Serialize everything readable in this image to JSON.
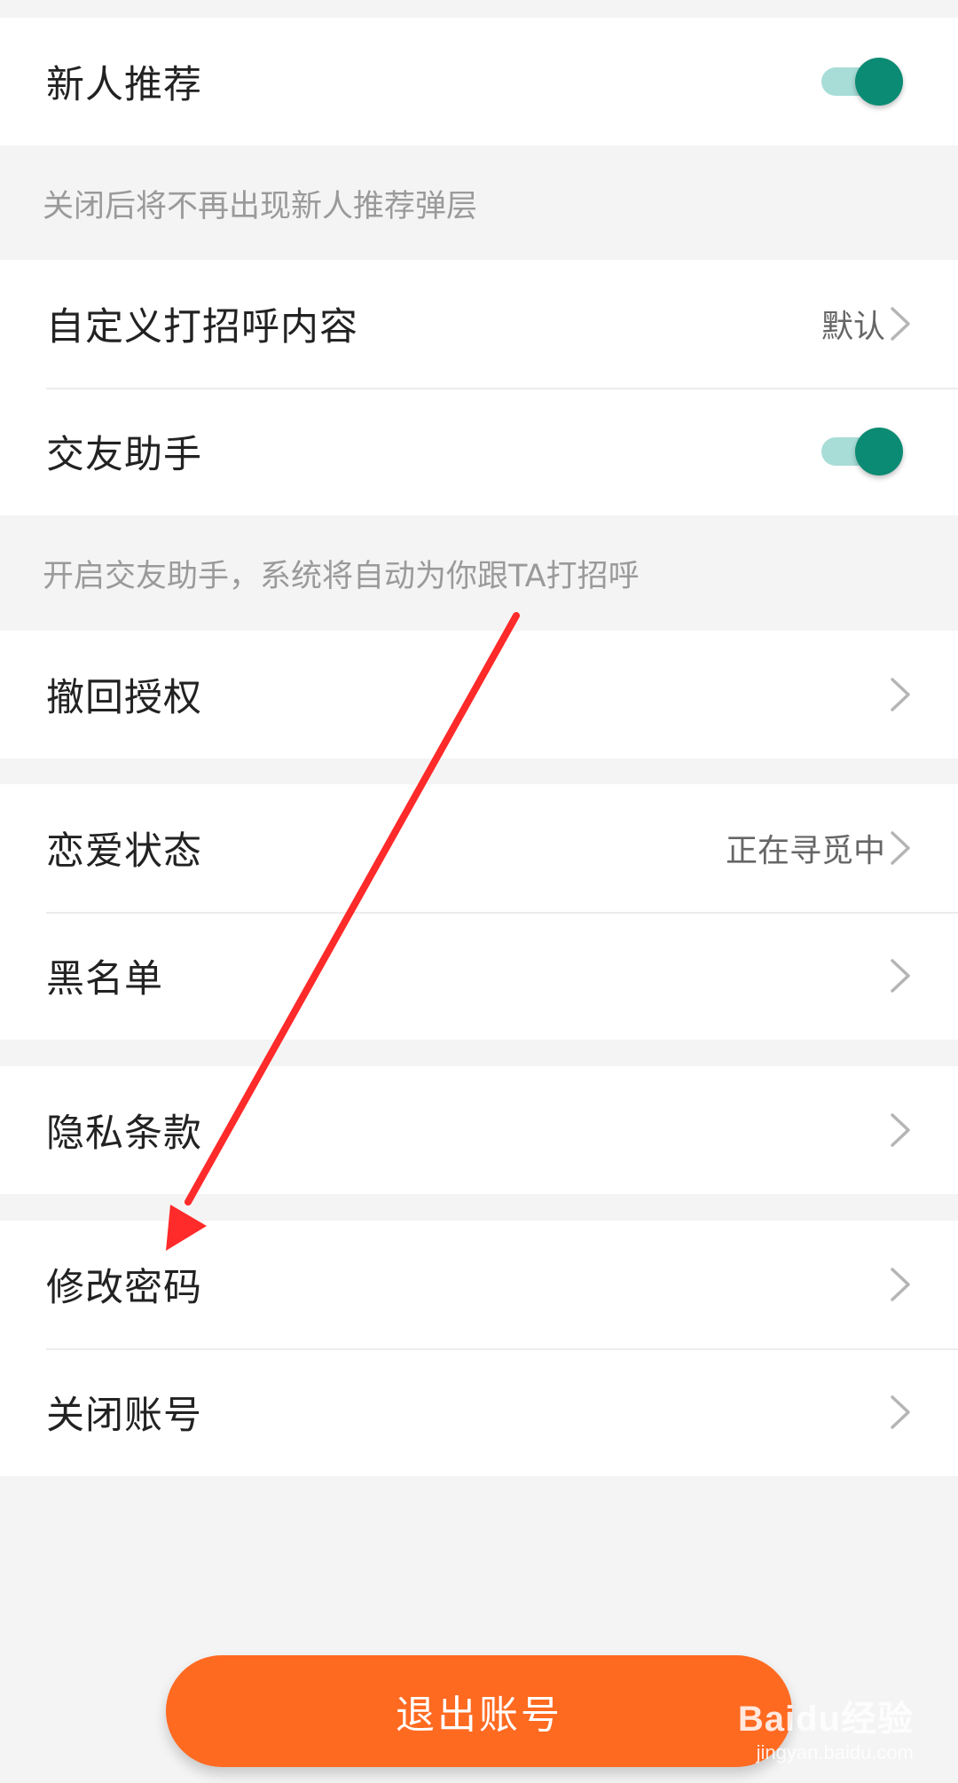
{
  "settings": {
    "newcomer_recommend": {
      "label": "新人推荐",
      "enabled": true,
      "note": "关闭后将不再出现新人推荐弹层"
    },
    "custom_greeting": {
      "label": "自定义打招呼内容",
      "value": "默认"
    },
    "dating_assistant": {
      "label": "交友助手",
      "enabled": true,
      "note": "开启交友助手，系统将自动为你跟TA打招呼"
    },
    "revoke_authorization": {
      "label": "撤回授权"
    },
    "relationship_status": {
      "label": "恋爱状态",
      "value": "正在寻觅中"
    },
    "blacklist": {
      "label": "黑名单"
    },
    "privacy_terms": {
      "label": "隐私条款"
    },
    "change_password": {
      "label": "修改密码"
    },
    "close_account": {
      "label": "关闭账号"
    }
  },
  "logout_button": {
    "label": "退出账号"
  },
  "watermark": {
    "brand": "Baidu经验",
    "url": "jingyan.baidu.com"
  },
  "colors": {
    "toggle_on_knob": "#0b8b73",
    "toggle_on_track": "#a8ddd7",
    "logout_button": "#ff6a21",
    "annotation_arrow": "#ff2a2a"
  },
  "icons": {
    "chevron": "chevron-right-icon"
  }
}
